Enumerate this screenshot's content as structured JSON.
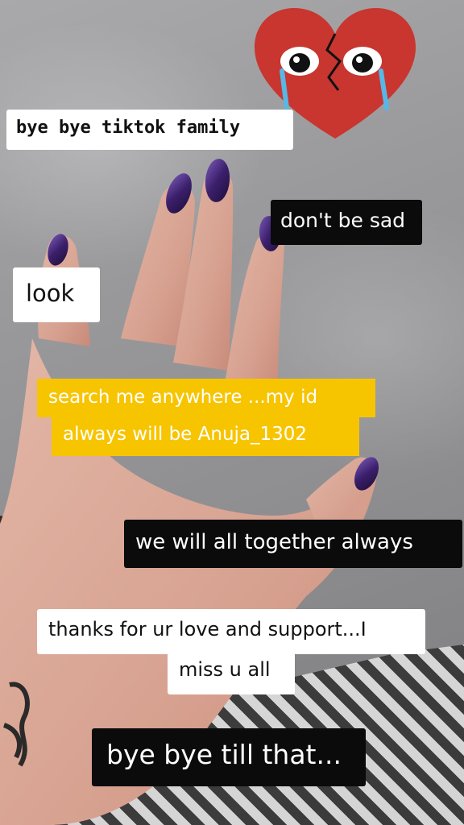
{
  "captions": {
    "bye_bye_family": "bye bye tiktok family",
    "dont_be_sad": "don't be sad",
    "look": "look",
    "search_line1": "search me anywhere ...my id",
    "search_line2": "always will be Anuja_1302",
    "together": "we will all together always",
    "thanks_line1": "thanks for ur love and support...I",
    "thanks_line2": "miss u all",
    "bye_bye_till": "bye bye till that..."
  },
  "colors": {
    "caption_yellow": "#f7c400",
    "caption_black": "#0b0b0b",
    "caption_white": "#ffffff",
    "nail_polish": "#3b1f6b",
    "heart_red": "#c8362f"
  },
  "stickers": {
    "heart": "crying-broken-heart-icon"
  }
}
